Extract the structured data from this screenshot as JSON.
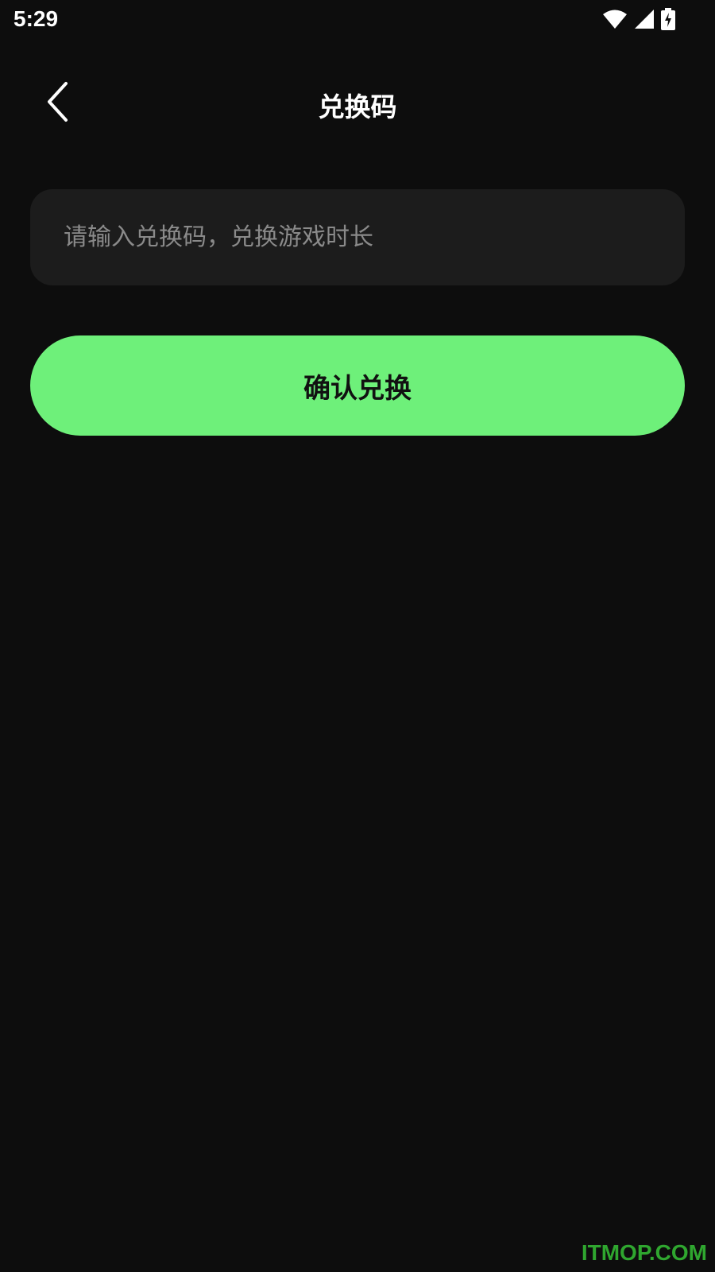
{
  "status_bar": {
    "time": "5:29",
    "icons": [
      "wifi-icon",
      "cell-signal-icon",
      "battery-charging-icon"
    ]
  },
  "header": {
    "title": "兑换码",
    "back_icon": "chevron-left-icon"
  },
  "redeem_form": {
    "input_value": "",
    "input_placeholder": "请输入兑换码，兑换游戏时长",
    "confirm_label": "确认兑换"
  },
  "watermark": "ITMOP.COM",
  "colors": {
    "background": "#0d0d0d",
    "input_background": "#1c1c1c",
    "accent": "#6ef07a",
    "watermark": "#2fa62f"
  }
}
